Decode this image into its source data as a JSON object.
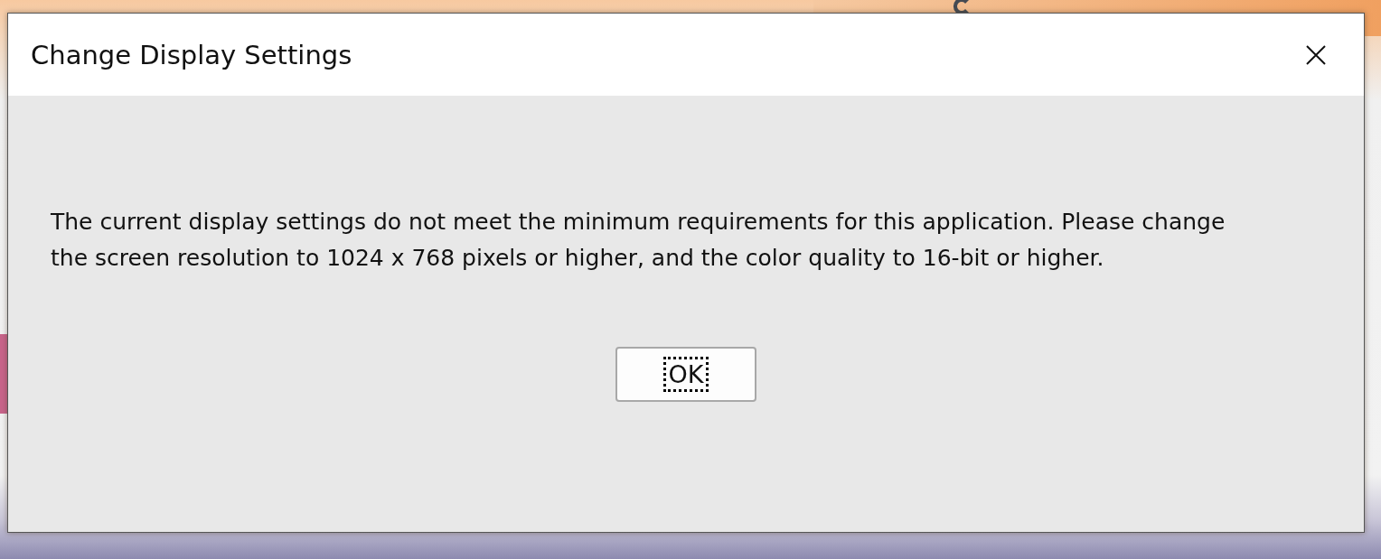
{
  "dialog": {
    "title": "Change Display Settings",
    "message": "The current display settings do not meet the minimum requirements for this application. Please change the screen resolution to 1024 x 768 pixels or higher, and the color quality to 16-bit or higher.",
    "buttons": [
      {
        "label": "OK",
        "focused": true
      }
    ]
  }
}
